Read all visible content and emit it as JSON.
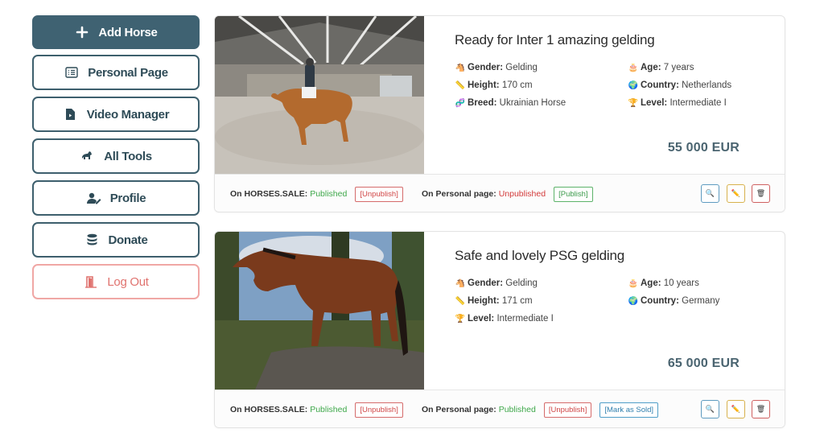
{
  "sidebar": {
    "add_horse": "Add Horse",
    "personal_page": "Personal Page",
    "video_manager": "Video Manager",
    "all_tools": "All Tools",
    "profile": "Profile",
    "donate": "Donate",
    "log_out": "Log Out"
  },
  "colors": {
    "primary": "#3f6272",
    "published": "#3ea84a",
    "unpublished": "#d33a3a",
    "price": "#4a6470"
  },
  "listings": [
    {
      "title": "Ready for Inter 1 amazing gelding",
      "gender_label": "Gender:",
      "gender": "Gelding",
      "age_label": "Age:",
      "age": "7 years",
      "height_label": "Height:",
      "height": "170 cm",
      "country_label": "Country:",
      "country": "Netherlands",
      "breed_label": "Breed:",
      "breed": "Ukrainian Horse",
      "level_label": "Level:",
      "level": "Intermediate I",
      "price": "55 000 EUR",
      "site_label": "On HORSES.SALE:",
      "site_status": "Published",
      "site_action": "[Unpublish]",
      "personal_label": "On Personal page:",
      "personal_status": "Unpublished",
      "personal_action": "[Publish]"
    },
    {
      "title": "Safe and lovely PSG gelding",
      "gender_label": "Gender:",
      "gender": "Gelding",
      "age_label": "Age:",
      "age": "10 years",
      "height_label": "Height:",
      "height": "171 cm",
      "country_label": "Country:",
      "country": "Germany",
      "level_label": "Level:",
      "level": "Intermediate I",
      "price": "65 000 EUR",
      "site_label": "On HORSES.SALE:",
      "site_status": "Published",
      "site_action": "[Unpublish]",
      "personal_label": "On Personal page:",
      "personal_status": "Published",
      "personal_action": "[Unpublish]",
      "sold_action": "[Mark as Sold]"
    }
  ]
}
